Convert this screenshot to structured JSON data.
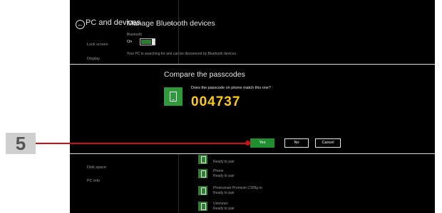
{
  "settings": {
    "pane_title": "PC and devices",
    "nav_items": [
      "Lock screen",
      "Display",
      "Disk space",
      "PC info"
    ]
  },
  "bluetooth": {
    "title": "Manage Bluetooth devices",
    "label": "Bluetooth",
    "state": "On",
    "status": "Your PC is searching for and can be discovered by Bluetooth devices.",
    "devices": [
      {
        "name": "",
        "status": "Ready to pair"
      },
      {
        "name": "Phone",
        "status": "Ready to pair"
      },
      {
        "name": "Photosmart Premium C309g-m",
        "status": "Ready to pair"
      },
      {
        "name": "Unknown",
        "status": "Ready to pair"
      }
    ]
  },
  "dialog": {
    "title": "Compare the passcodes",
    "question": "Does the passcode on phone match this one?",
    "passcode": "004737",
    "yes_label": "Yes",
    "no_label": "No",
    "cancel_label": "Cancel"
  },
  "callout": {
    "step": "5",
    "color": "#d01010"
  },
  "colors": {
    "accent": "#2e9a3a",
    "passcode": "#ffcc00"
  }
}
